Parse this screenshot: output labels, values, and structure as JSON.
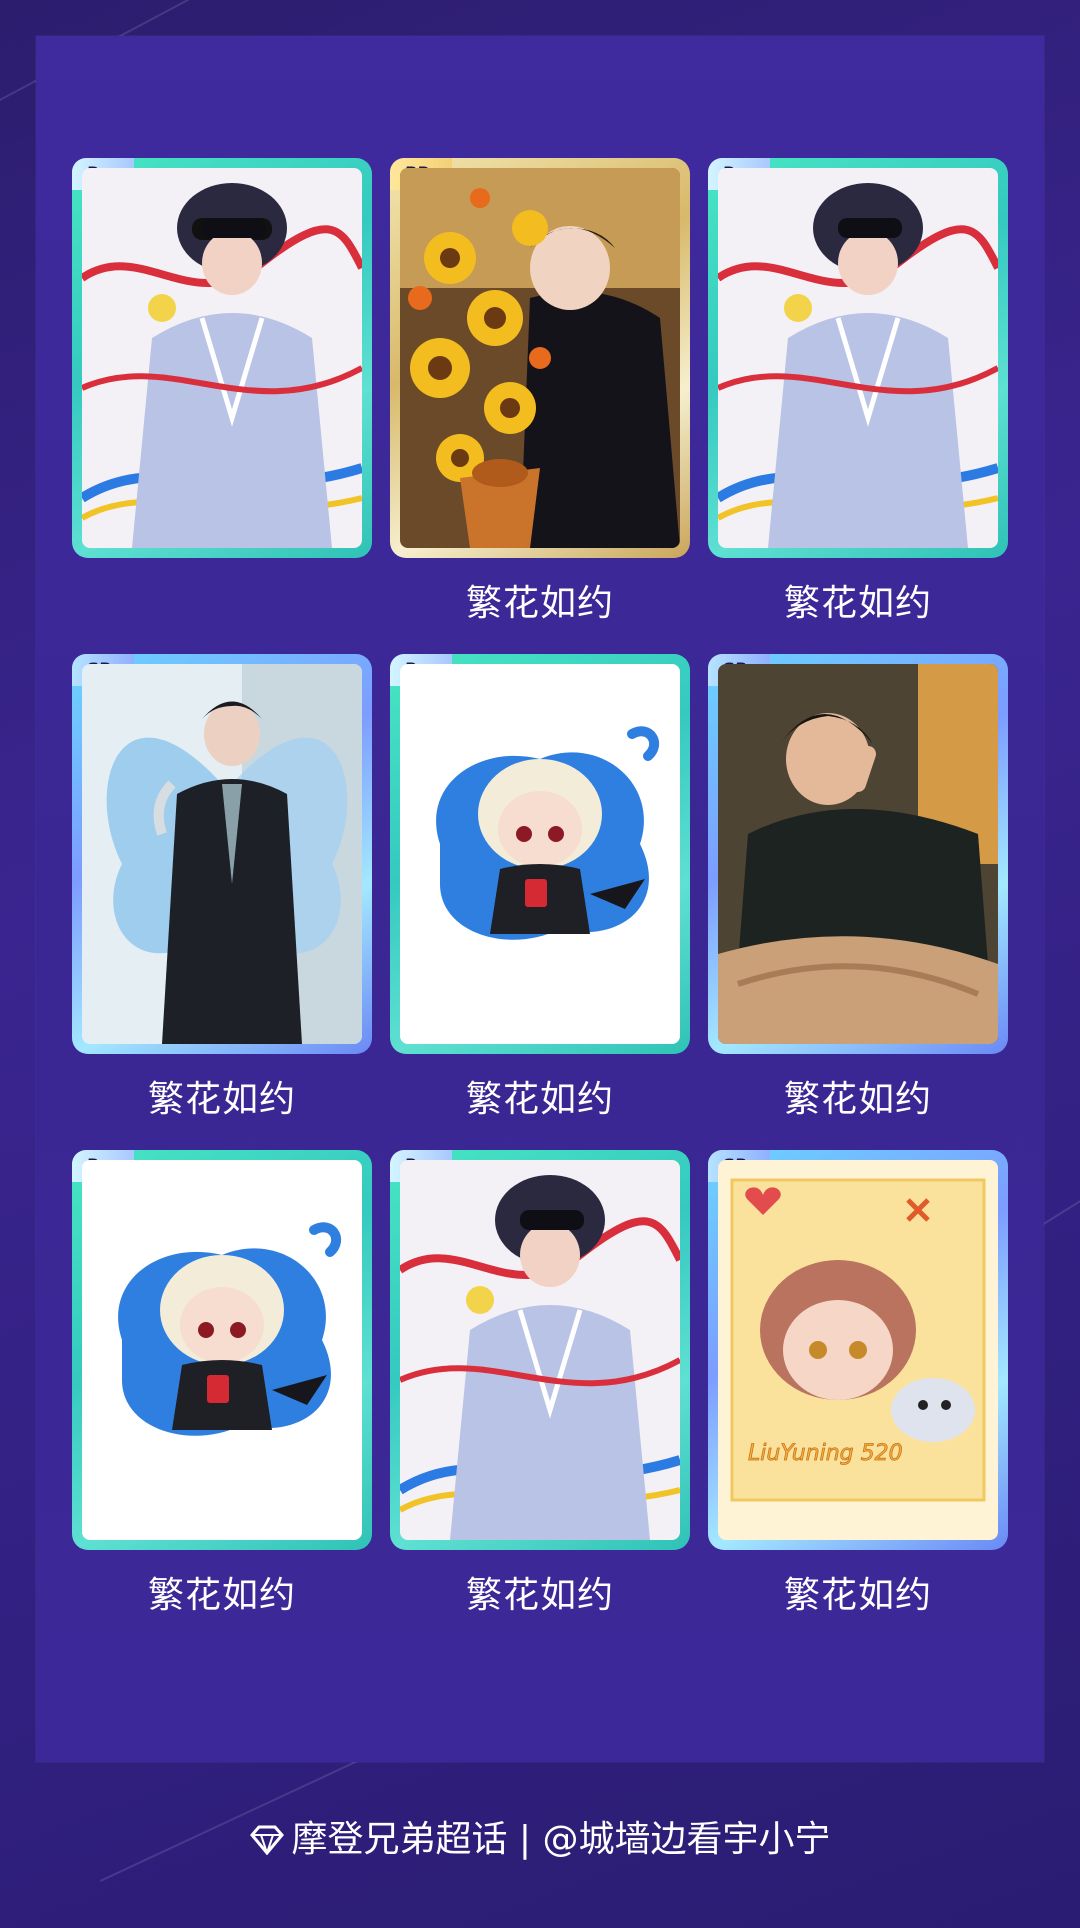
{
  "grid": {
    "cards": [
      {
        "rarity": "R",
        "caption": "",
        "art": "masked-idol-art"
      },
      {
        "rarity": "PR",
        "caption": "繁花如约",
        "art": "sunflower-bouquet-art"
      },
      {
        "rarity": "R",
        "caption": "繁花如约",
        "art": "masked-idol-art"
      },
      {
        "rarity": "SR",
        "caption": "繁花如约",
        "art": "butterfly-wings-art"
      },
      {
        "rarity": "R",
        "caption": "繁花如约",
        "art": "chibi-blond-art"
      },
      {
        "rarity": "SR",
        "caption": "繁花如约",
        "art": "black-sweater-art"
      },
      {
        "rarity": "R",
        "caption": "繁花如约",
        "art": "chibi-blond-art"
      },
      {
        "rarity": "R",
        "caption": "繁花如约",
        "art": "masked-idol-art"
      },
      {
        "rarity": "SR",
        "caption": "繁花如约",
        "art": "chibi-puppy-art"
      }
    ]
  },
  "chibi_puppy_lettering": "LiuYuning 520",
  "footer": {
    "icon": "diamond-icon",
    "text": "摩登兄弟超话 | @城墙边看宇小宁"
  }
}
